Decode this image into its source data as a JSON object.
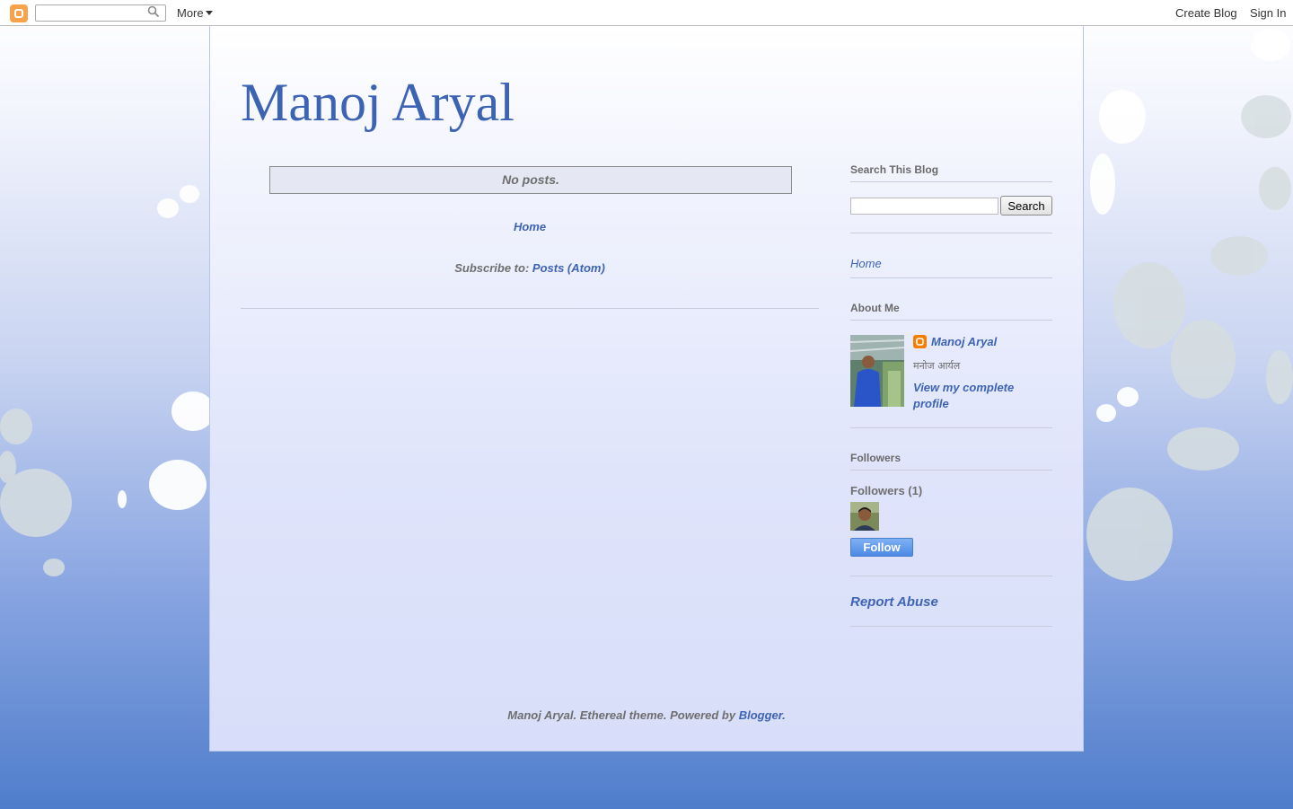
{
  "navbar": {
    "logo_icon": "blogger-logo-icon",
    "search_placeholder": "",
    "search_icon": "search-icon",
    "more_label": "More",
    "create_blog_label": "Create Blog",
    "sign_in_label": "Sign In"
  },
  "blog": {
    "title": "Manoj Aryal"
  },
  "main": {
    "no_posts": "No posts.",
    "home_link": "Home",
    "subscribe_prefix": "Subscribe to:",
    "subscribe_link": "Posts (Atom)"
  },
  "sidebar": {
    "search": {
      "heading": "Search This Blog",
      "input_value": "",
      "button_label": "Search"
    },
    "pages": {
      "home_link": "Home"
    },
    "about": {
      "heading": "About Me",
      "name": "Manoj Aryal",
      "description": "मनोज आर्यल",
      "view_profile": "View my complete profile"
    },
    "followers": {
      "heading": "Followers",
      "count_label": "Followers (1)",
      "follow_button": "Follow"
    },
    "report_abuse": "Report Abuse"
  },
  "footer": {
    "text": "Manoj Aryal. Ethereal theme. Powered by",
    "link": "Blogger."
  },
  "colors": {
    "link": "#3d64b4",
    "text": "#6e6e6e",
    "background_bottom": "#4f7dcb"
  }
}
